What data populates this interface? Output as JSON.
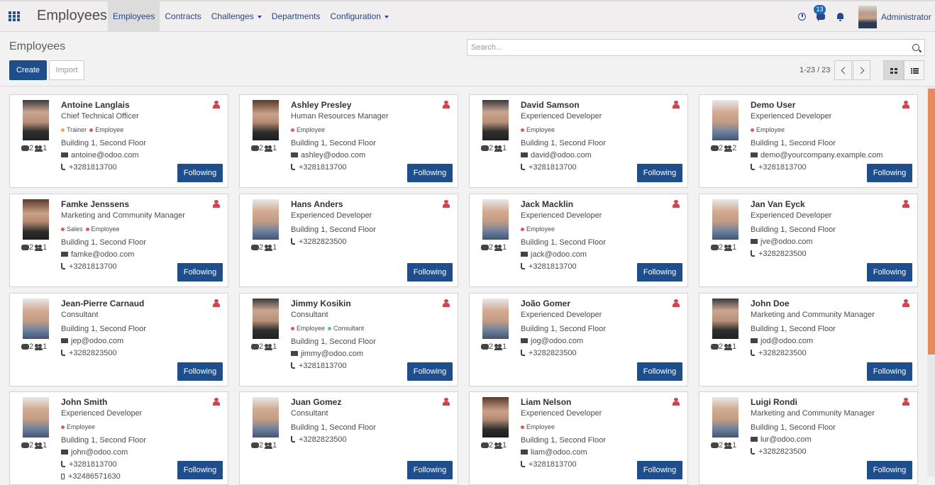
{
  "app_title": "Employees",
  "menu": [
    {
      "label": "Employees",
      "active": true,
      "dropdown": false
    },
    {
      "label": "Contracts",
      "active": false,
      "dropdown": false
    },
    {
      "label": "Challenges",
      "active": false,
      "dropdown": true
    },
    {
      "label": "Departments",
      "active": false,
      "dropdown": false
    },
    {
      "label": "Configuration",
      "active": false,
      "dropdown": true
    }
  ],
  "systray": {
    "messages_badge": "13",
    "user_name": "Administrator",
    "icons": [
      "clock-icon",
      "chat-icon",
      "bell-icon"
    ]
  },
  "control_panel": {
    "title": "Employees",
    "search_placeholder": "Search...",
    "create_label": "Create",
    "import_label": "Import",
    "pager": "1-23 / 23",
    "views": [
      "kanban",
      "list"
    ],
    "active_view": "kanban"
  },
  "colors": {
    "primary": "#1f4e8c",
    "nav_link": "#28478a",
    "person_icon": "#d0454c",
    "scroll_thumb": "#e48a5f",
    "tag_trainer": "#f0a25a",
    "tag_employee": "#e05a5a",
    "tag_sales": "#e05a5a",
    "tag_consultant": "#5bb5e0"
  },
  "follow_label": "Following",
  "employees": [
    {
      "name": "Antoine Langlais",
      "job": "Chief Technical Officer",
      "tags": [
        {
          "label": "Trainer",
          "color": "#f0a25a"
        },
        {
          "label": "Employee",
          "color": "#e05a5a"
        }
      ],
      "location": "Building 1, Second Floor",
      "email": "antoine@odoo.com",
      "phone": "+3281813700",
      "messages": "2",
      "followers": "1"
    },
    {
      "name": "Ashley Presley",
      "job": "Human Resources Manager",
      "tags": [
        {
          "label": "Employee",
          "color": "#e05a5a"
        }
      ],
      "location": "Building 1, Second Floor",
      "email": "ashley@odoo.com",
      "phone": "+3281813700",
      "messages": "2",
      "followers": "1"
    },
    {
      "name": "David Samson",
      "job": "Experienced Developer",
      "tags": [
        {
          "label": "Employee",
          "color": "#e05a5a"
        }
      ],
      "location": "Building 1, Second Floor",
      "email": "david@odoo.com",
      "phone": "+3281813700",
      "messages": "2",
      "followers": "1"
    },
    {
      "name": "Demo User",
      "job": "Experienced Developer",
      "tags": [
        {
          "label": "Employee",
          "color": "#e05a5a"
        }
      ],
      "location": "Building 1, Second Floor",
      "email": "demo@yourcompany.example.com",
      "phone": "+3281813700",
      "messages": "2",
      "followers": "2"
    },
    {
      "name": "Famke Jenssens",
      "job": "Marketing and Community Manager",
      "tags": [
        {
          "label": "Sales",
          "color": "#e05a5a"
        },
        {
          "label": "Employee",
          "color": "#e05a5a"
        }
      ],
      "location": "Building 1, Second Floor",
      "email": "famke@odoo.com",
      "phone": "+3281813700",
      "messages": "2",
      "followers": "1"
    },
    {
      "name": "Hans Anders",
      "job": "Experienced Developer",
      "tags": [],
      "location": "Building 1, Second Floor",
      "email": "",
      "phone": "+3282823500",
      "messages": "2",
      "followers": "1"
    },
    {
      "name": "Jack Macklin",
      "job": "Experienced Developer",
      "tags": [
        {
          "label": "Employee",
          "color": "#e05a5a"
        }
      ],
      "location": "Building 1, Second Floor",
      "email": "jack@odoo.com",
      "phone": "+3281813700",
      "messages": "2",
      "followers": "1"
    },
    {
      "name": "Jan Van Eyck",
      "job": "Experienced Developer",
      "tags": [],
      "location": "Building 1, Second Floor",
      "email": "jve@odoo.com",
      "phone": "+3282823500",
      "messages": "2",
      "followers": "1"
    },
    {
      "name": "Jean-Pierre Carnaud",
      "job": "Consultant",
      "tags": [],
      "location": "Building 1, Second Floor",
      "email": "jep@odoo.com",
      "phone": "+3282823500",
      "messages": "2",
      "followers": "1"
    },
    {
      "name": "Jimmy Kosikin",
      "job": "Consultant",
      "tags": [
        {
          "label": "Employee",
          "color": "#e05a5a"
        },
        {
          "label": "Consultant",
          "color": "#5bb5e0"
        }
      ],
      "location": "Building 1, Second Floor",
      "email": "jimmy@odoo.com",
      "phone": "+3281813700",
      "messages": "2",
      "followers": "1"
    },
    {
      "name": "João Gomer",
      "job": "Experienced Developer",
      "tags": [],
      "location": "Building 1, Second Floor",
      "email": "jog@odoo.com",
      "phone": "+3282823500",
      "messages": "2",
      "followers": "1"
    },
    {
      "name": "John Doe",
      "job": "Marketing and Community Manager",
      "tags": [],
      "location": "Building 1, Second Floor",
      "email": "jod@odoo.com",
      "phone": "+3282823500",
      "messages": "2",
      "followers": "1"
    },
    {
      "name": "John Smith",
      "job": "Experienced Developer",
      "tags": [
        {
          "label": "Employee",
          "color": "#e05a5a"
        }
      ],
      "location": "Building 1, Second Floor",
      "email": "john@odoo.com",
      "phone": "+3281813700",
      "mobile": "+32486571630",
      "messages": "2",
      "followers": "1"
    },
    {
      "name": "Juan Gomez",
      "job": "Consultant",
      "tags": [],
      "location": "Building 1, Second Floor",
      "email": "",
      "phone": "+3282823500",
      "messages": "2",
      "followers": "1"
    },
    {
      "name": "Liam Nelson",
      "job": "Experienced Developer",
      "tags": [
        {
          "label": "Employee",
          "color": "#e05a5a"
        }
      ],
      "location": "Building 1, Second Floor",
      "email": "liam@odoo.com",
      "phone": "+3281813700",
      "messages": "2",
      "followers": "1"
    },
    {
      "name": "Luigi Rondi",
      "job": "Marketing and Community Manager",
      "tags": [],
      "location": "Building 1, Second Floor",
      "email": "lur@odoo.com",
      "phone": "+3282823500",
      "messages": "2",
      "followers": "1"
    }
  ]
}
